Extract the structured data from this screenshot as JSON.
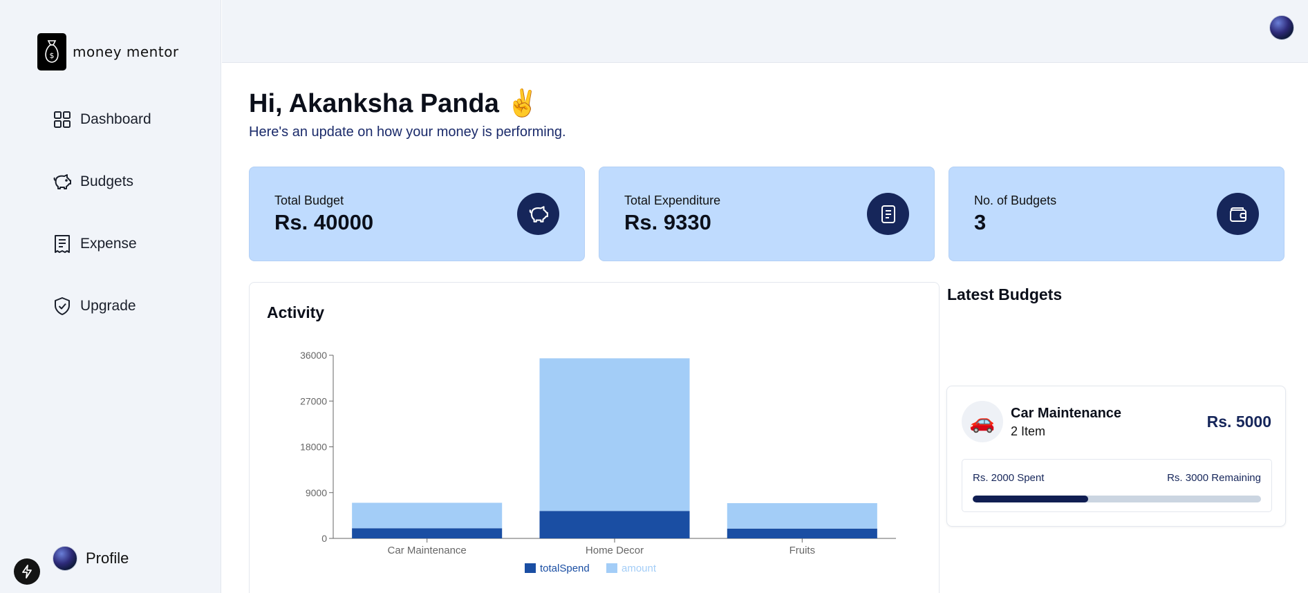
{
  "app": {
    "name": "money mentor"
  },
  "sidebar": {
    "items": [
      {
        "label": "Dashboard",
        "icon": "dashboard-grid-icon"
      },
      {
        "label": "Budgets",
        "icon": "piggy-bank-icon"
      },
      {
        "label": "Expense",
        "icon": "receipt-icon"
      },
      {
        "label": "Upgrade",
        "icon": "shield-check-icon"
      }
    ],
    "profile_label": "Profile"
  },
  "header": {
    "greeting": "Hi, Akanksha Panda ✌️",
    "subtitle": "Here's an update on how your money is performing."
  },
  "cards": [
    {
      "label": "Total Budget",
      "value": "Rs. 40000",
      "icon": "piggy-bank-icon"
    },
    {
      "label": "Total Expenditure",
      "value": "Rs. 9330",
      "icon": "receipt-icon"
    },
    {
      "label": "No. of Budgets",
      "value": "3",
      "icon": "wallet-icon"
    }
  ],
  "activity": {
    "title": "Activity"
  },
  "chart_data": {
    "type": "bar",
    "stacked": true,
    "categories": [
      "Car Maintenance",
      "Home Decor",
      "Fruits"
    ],
    "series": [
      {
        "name": "totalSpend",
        "values": [
          2000,
          5400,
          1930
        ],
        "color": "#1a4ea3"
      },
      {
        "name": "amount",
        "values": [
          5000,
          30000,
          5000
        ],
        "color": "#a3cdf7"
      }
    ],
    "yticks": [
      0,
      9000,
      18000,
      27000,
      36000
    ],
    "ylim": [
      0,
      36000
    ],
    "legend": "bottom"
  },
  "latest": {
    "title": "Latest Budgets",
    "budgets": [
      {
        "emoji": "🚗",
        "name": "Car Maintenance",
        "items": "2 Item",
        "amount": "Rs. 5000",
        "spent": "Rs. 2000 Spent",
        "remaining": "Rs. 3000 Remaining",
        "progress": 0.4
      }
    ]
  },
  "colors": {
    "accent": "#16265a",
    "card_bg": "#bfdbfe",
    "sidebar_bg": "#f1f4f9"
  }
}
